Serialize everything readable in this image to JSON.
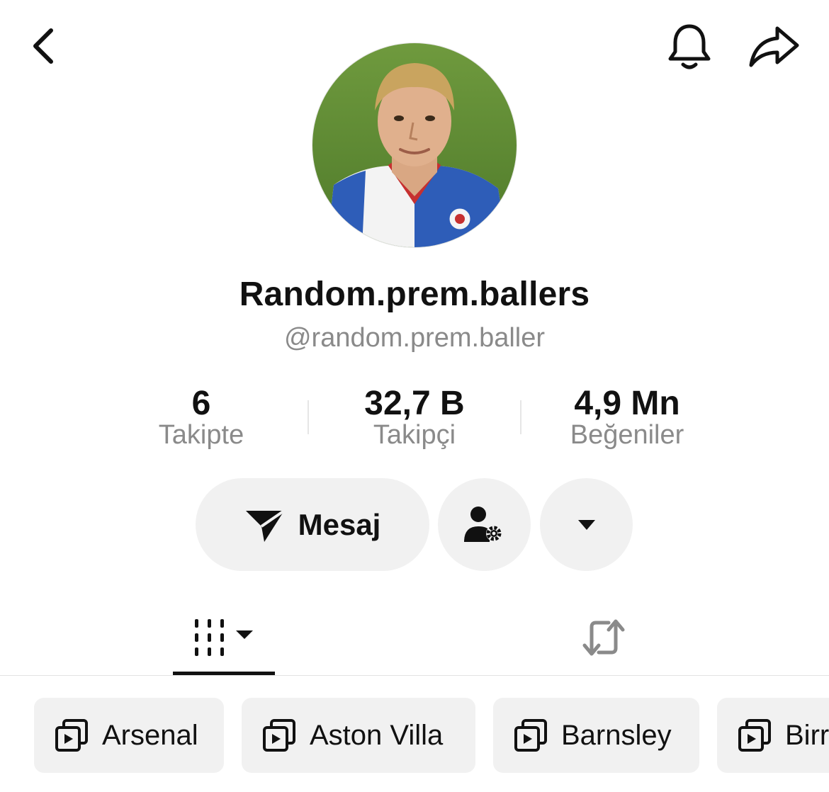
{
  "header": {
    "back_icon": "chevron-left-icon",
    "bell_icon": "bell-icon",
    "share_icon": "share-arrow-icon"
  },
  "profile": {
    "display_name": "Random.prem.ballers",
    "handle": "@random.prem.baller"
  },
  "stats": [
    {
      "value": "6",
      "label": "Takipte"
    },
    {
      "value": "32,7 B",
      "label": "Takipçi"
    },
    {
      "value": "4,9 Mn",
      "label": "Beğeniler"
    }
  ],
  "actions": {
    "message_label": "Mesaj",
    "message_icon": "send-icon",
    "friend_icon": "user-settings-icon",
    "more_icon": "caret-down-icon"
  },
  "tabs": [
    {
      "icon": "video-grid-icon",
      "active": true
    },
    {
      "icon": "repost-icon",
      "active": false
    }
  ],
  "playlists": [
    {
      "label": "Arsenal"
    },
    {
      "label": "Aston Villa"
    },
    {
      "label": "Barnsley"
    },
    {
      "label": "Birr"
    }
  ],
  "colors": {
    "accent": "#111111",
    "muted_text": "#8a8a8a",
    "pill_bg": "#f1f1f1"
  }
}
